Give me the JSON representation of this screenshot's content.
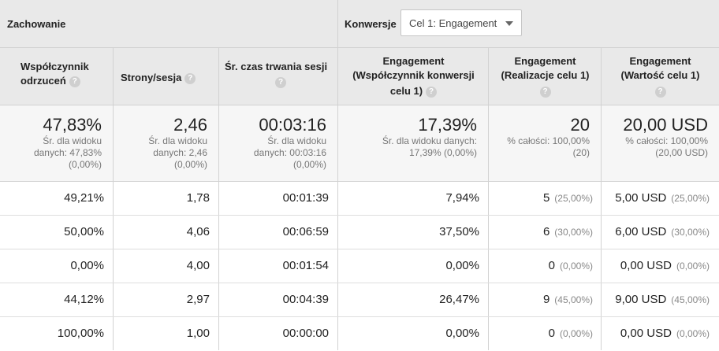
{
  "sections": {
    "behavior_label": "Zachowanie",
    "conversions_label": "Konwersje",
    "goal_selector_value": "Cel 1: Engagement"
  },
  "columns": {
    "bounce_rate": {
      "title_line1": "Współczynnik",
      "title_line2": "odrzuceń"
    },
    "pages_per_session": {
      "title": "Strony/sesja"
    },
    "avg_session_duration": {
      "title": "Śr. czas trwania sesji"
    },
    "conv_rate": {
      "title_line1": "Engagement",
      "title_line2": "(Współczynnik konwersji",
      "title_line3": "celu 1)"
    },
    "completions": {
      "title_line1": "Engagement",
      "title_line2": "(Realizacje celu 1)"
    },
    "value": {
      "title_line1": "Engagement",
      "title_line2": "(Wartość celu 1)"
    },
    "help_glyph": "?"
  },
  "totals": {
    "bounce_rate": {
      "main": "47,83%",
      "sub1": "Śr. dla widoku",
      "sub2": "danych: 47,83%",
      "sub3": "(0,00%)"
    },
    "pages_per_session": {
      "main": "2,46",
      "sub1": "Śr. dla widoku",
      "sub2": "danych: 2,46",
      "sub3": "(0,00%)"
    },
    "avg_session_duration": {
      "main": "00:03:16",
      "sub1": "Śr. dla widoku",
      "sub2": "danych: 00:03:16",
      "sub3": "(0,00%)"
    },
    "conv_rate": {
      "main": "17,39%",
      "sub1": "Śr. dla widoku danych:",
      "sub2": "17,39% (0,00%)"
    },
    "completions": {
      "main": "20",
      "sub1": "% całości: 100,00%",
      "sub2": "(20)"
    },
    "value": {
      "main": "20,00 USD",
      "sub1": "% całości: 100,00%",
      "sub2": "(20,00 USD)"
    }
  },
  "rows": [
    {
      "bounce": "49,21%",
      "pages": "1,78",
      "duration": "00:01:39",
      "conv": "7,94%",
      "compl": "5",
      "compl_pct": "(25,00%)",
      "value": "5,00 USD",
      "value_pct": "(25,00%)"
    },
    {
      "bounce": "50,00%",
      "pages": "4,06",
      "duration": "00:06:59",
      "conv": "37,50%",
      "compl": "6",
      "compl_pct": "(30,00%)",
      "value": "6,00 USD",
      "value_pct": "(30,00%)"
    },
    {
      "bounce": "0,00%",
      "pages": "4,00",
      "duration": "00:01:54",
      "conv": "0,00%",
      "compl": "0",
      "compl_pct": "(0,00%)",
      "value": "0,00 USD",
      "value_pct": "(0,00%)"
    },
    {
      "bounce": "44,12%",
      "pages": "2,97",
      "duration": "00:04:39",
      "conv": "26,47%",
      "compl": "9",
      "compl_pct": "(45,00%)",
      "value": "9,00 USD",
      "value_pct": "(45,00%)"
    },
    {
      "bounce": "100,00%",
      "pages": "1,00",
      "duration": "00:00:00",
      "conv": "0,00%",
      "compl": "0",
      "compl_pct": "(0,00%)",
      "value": "0,00 USD",
      "value_pct": "(0,00%)"
    }
  ]
}
